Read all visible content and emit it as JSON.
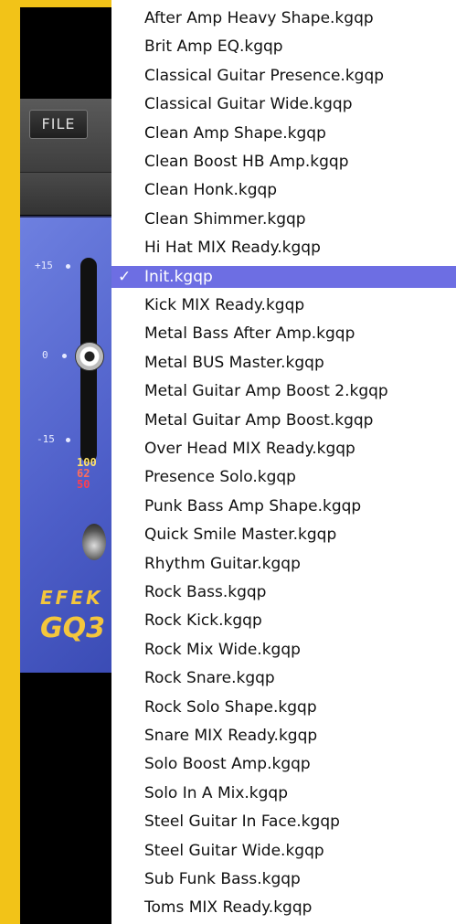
{
  "plugin": {
    "file_label": "FILE",
    "scale": {
      "top": "+15",
      "mid": "0",
      "bottom": "-15"
    },
    "meter": [
      "100",
      "62",
      "50"
    ],
    "meter_colors": [
      "#ffe36a",
      "#ff6d5a",
      "#ff3f4f"
    ],
    "brand": "EFEK",
    "model": "GQ3"
  },
  "menu": {
    "check_glyph": "✓",
    "items": [
      "After Amp Heavy Shape.kgqp",
      "Brit Amp EQ.kgqp",
      "Classical Guitar Presence.kgqp",
      "Classical Guitar Wide.kgqp",
      "Clean Amp Shape.kgqp",
      "Clean Boost HB Amp.kgqp",
      "Clean Honk.kgqp",
      "Clean Shimmer.kgqp",
      "Hi Hat MIX Ready.kgqp",
      "Init.kgqp",
      "Kick MIX Ready.kgqp",
      "Metal Bass After Amp.kgqp",
      "Metal BUS Master.kgqp",
      "Metal Guitar Amp Boost 2.kgqp",
      "Metal Guitar Amp Boost.kgqp",
      "Over Head MIX Ready.kgqp",
      "Presence Solo.kgqp",
      "Punk Bass Amp Shape.kgqp",
      "Quick Smile Master.kgqp",
      "Rhythm Guitar.kgqp",
      "Rock Bass.kgqp",
      "Rock Kick.kgqp",
      "Rock Mix Wide.kgqp",
      "Rock Snare.kgqp",
      "Rock Solo Shape.kgqp",
      "Snare MIX Ready.kgqp",
      "Solo Boost Amp.kgqp",
      "Solo In A Mix.kgqp",
      "Steel Guitar In Face.kgqp",
      "Steel Guitar Wide.kgqp",
      "Sub Funk Bass.kgqp",
      "Toms MIX Ready.kgqp"
    ],
    "selected_index": 9
  },
  "colors": {
    "highlight": "#6d6ee3",
    "panel": "#5566d0",
    "accent": "#f2c318"
  }
}
